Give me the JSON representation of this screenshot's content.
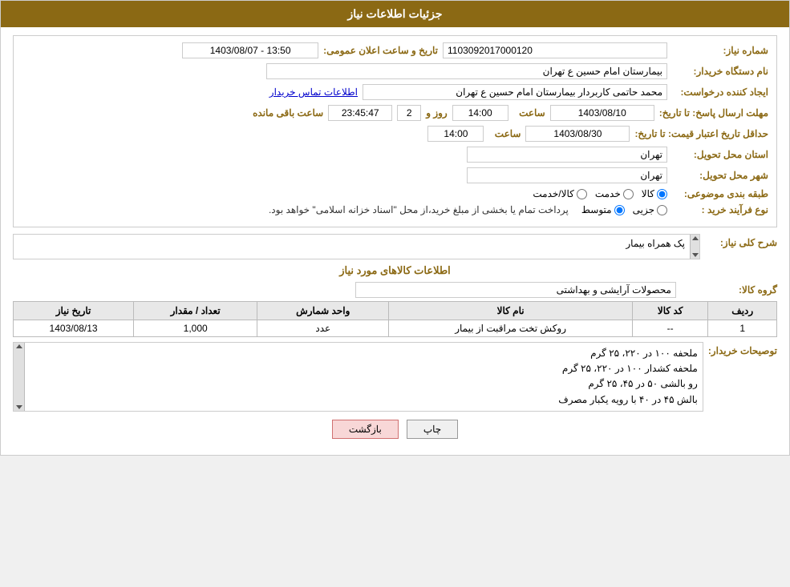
{
  "header": {
    "title": "جزئیات اطلاعات نیاز"
  },
  "form": {
    "shomareNiaz_label": "شماره نیاز:",
    "shomareNiaz_value": "1103092017000120",
    "namDastgah_label": "نام دستگاه خریدار:",
    "namDastgah_value": "بیمارستان امام حسین  ع  تهران",
    "tarikhElan_label": "تاریخ و ساعت اعلان عمومی:",
    "tarikhElan_value": "1403/08/07 - 13:50",
    "ijadKonande_label": "ایجاد کننده درخواست:",
    "ijadKonande_value": "محمد حاتمی کاربردار بیمارستان امام حسین  ع  تهران",
    "ettelaatTamas_text": "اطلاعات تماس خریدار",
    "mohlat_label": "مهلت ارسال پاسخ: تا تاریخ:",
    "mohlat_date": "1403/08/10",
    "mohlat_time": "14:00",
    "mohlat_days": "2",
    "mohlat_remaining_time": "23:45:47",
    "mohlat_remaining_label": "روز و",
    "mohlat_remaining_label2": "ساعت باقی مانده",
    "hadaqal_label": "حداقل تاریخ اعتبار قیمت: تا تاریخ:",
    "hadaqal_date": "1403/08/30",
    "hadaqal_time": "14:00",
    "ostan_label": "استان محل تحویل:",
    "ostan_value": "تهران",
    "shahr_label": "شهر محل تحویل:",
    "shahr_value": "تهران",
    "tabaqe_label": "طبقه بندی موضوعی:",
    "tabaqe_options": [
      "کالا",
      "خدمت",
      "کالا/خدمت"
    ],
    "tabaqe_selected": "کالا",
    "noefarayand_label": "نوع فرآیند خرید :",
    "noefarayand_options": [
      "جزیی",
      "متوسط"
    ],
    "noefarayand_selected": "متوسط",
    "noefarayand_desc": "پرداخت تمام یا بخشی از مبلغ خرید،از محل \"اسناد خزانه اسلامی\" خواهد بود.",
    "sharhKoli_label": "شرح کلی نیاز:",
    "sharhKoli_value": "پک همراه بیمار",
    "kalaInfo_title": "اطلاعات کالاهای مورد نیاز",
    "geroheKala_label": "گروه کالا:",
    "geroheKala_value": "محصولات آرایشی و بهداشتی",
    "table": {
      "headers": [
        "ردیف",
        "کد کالا",
        "نام کالا",
        "واحد شمارش",
        "تعداد / مقدار",
        "تاریخ نیاز"
      ],
      "rows": [
        {
          "radif": "1",
          "kod": "--",
          "name": "روکش تخت مراقبت از بیمار",
          "vahed": "عدد",
          "tedad": "1,000",
          "tarikh": "1403/08/13"
        }
      ]
    },
    "toseiyat_label": "توصیحات خریدار:",
    "toseiyat_lines": [
      "ملحفه ۱۰۰ در ۲۲۰، ۲۵ گرم",
      "ملحفه کشدار ۱۰۰ در ۲۲۰، ۲۵ گرم",
      "رو بالشی ۵۰ در ۴۵، ۲۵ گرم",
      "بالش ۴۵ در ۴۰ با رویه یکبار مصرف"
    ]
  },
  "buttons": {
    "print_label": "چاپ",
    "back_label": "بازگشت"
  }
}
